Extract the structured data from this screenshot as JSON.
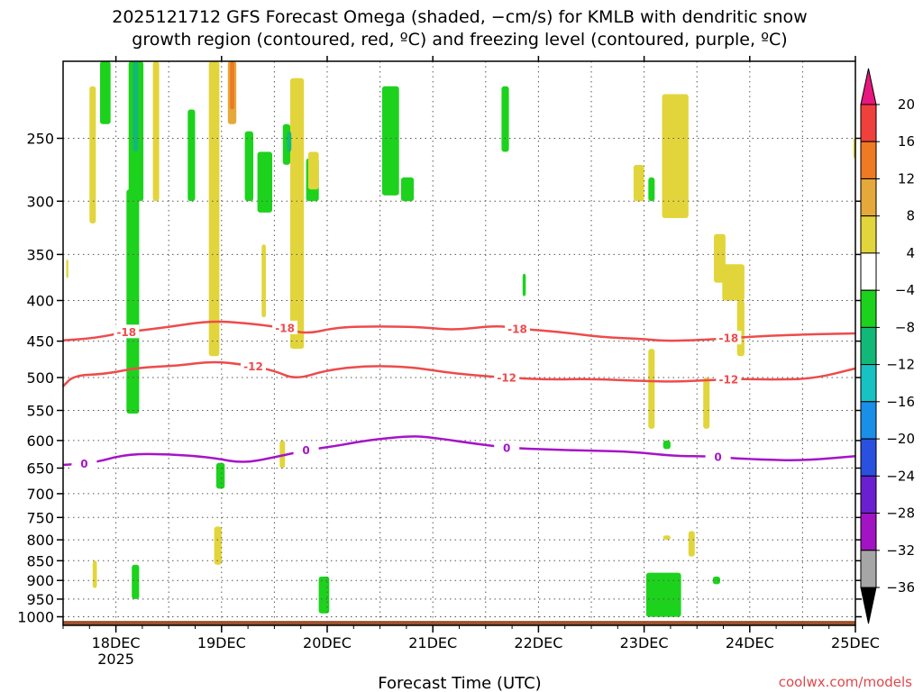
{
  "chart_data": {
    "type": "heatmap",
    "title_lines": [
      "2025121712 GFS Forecast Omega (shaded, −cm/s) for KMLB with dendritic snow",
      "growth region (contoured, red, ºC) and freezing level (contoured, purple, ºC)"
    ],
    "xlabel": "Forecast Time (UTC)",
    "x_ticks": [
      "18DEC",
      "19DEC",
      "20DEC",
      "21DEC",
      "22DEC",
      "23DEC",
      "24DEC",
      "25DEC"
    ],
    "x_tick_year": "2025",
    "x_range_days": [
      17.5,
      25.0
    ],
    "y_ticks": [
      250,
      300,
      350,
      400,
      450,
      500,
      550,
      600,
      650,
      700,
      750,
      800,
      850,
      900,
      950,
      1000
    ],
    "y_range_hpa": [
      200,
      1025
    ],
    "y_scale": "log-pressure, inverted",
    "grid": true,
    "colorbar": {
      "labels": [
        "20",
        "16",
        "12",
        "8",
        "4",
        "−4",
        "−8",
        "−12",
        "−16",
        "−20",
        "−24",
        "−28",
        "−32",
        "−36"
      ],
      "bins": [
        {
          "color": "#e8167f"
        },
        {
          "color": "#f0403c"
        },
        {
          "color": "#ee7a23"
        },
        {
          "color": "#e5a83a"
        },
        {
          "color": "#e2d53b"
        },
        {
          "color": "#ffffff"
        },
        {
          "color": "#1dd21d"
        },
        {
          "color": "#12b877"
        },
        {
          "color": "#17c2c2"
        },
        {
          "color": "#1a8fe8"
        },
        {
          "color": "#2a50e0"
        },
        {
          "color": "#6a20d0"
        },
        {
          "color": "#a213c4"
        },
        {
          "color": "#a6a6a6"
        },
        {
          "color": "#000000"
        }
      ]
    },
    "contours": [
      {
        "label": "-18",
        "color": "#ee4b4b",
        "label_at": [
          18.1,
          19.6,
          21.8,
          23.8
        ],
        "points": [
          [
            17.5,
            449
          ],
          [
            17.8,
            446
          ],
          [
            18.1,
            438
          ],
          [
            18.5,
            432
          ],
          [
            18.9,
            424
          ],
          [
            19.3,
            428
          ],
          [
            19.6,
            433
          ],
          [
            19.8,
            441
          ],
          [
            20.1,
            432
          ],
          [
            20.5,
            431
          ],
          [
            20.9,
            432
          ],
          [
            21.2,
            436
          ],
          [
            21.6,
            430
          ],
          [
            21.8,
            434
          ],
          [
            22.2,
            438
          ],
          [
            22.6,
            445
          ],
          [
            23.0,
            447
          ],
          [
            23.2,
            450
          ],
          [
            23.6,
            448
          ],
          [
            23.8,
            446
          ],
          [
            24.2,
            443
          ],
          [
            24.6,
            441
          ],
          [
            25.0,
            440
          ]
        ]
      },
      {
        "label": "-12",
        "color": "#ee4b4b",
        "label_at": [
          19.3,
          21.7,
          23.8
        ],
        "points": [
          [
            17.5,
            513
          ],
          [
            17.6,
            497
          ],
          [
            17.9,
            495
          ],
          [
            18.2,
            486
          ],
          [
            18.6,
            483
          ],
          [
            18.9,
            477
          ],
          [
            19.2,
            481
          ],
          [
            19.5,
            490
          ],
          [
            19.7,
            503
          ],
          [
            20.0,
            489
          ],
          [
            20.4,
            483
          ],
          [
            20.8,
            485
          ],
          [
            21.1,
            492
          ],
          [
            21.4,
            497
          ],
          [
            21.7,
            500
          ],
          [
            22.1,
            503
          ],
          [
            22.5,
            502
          ],
          [
            23.0,
            505
          ],
          [
            23.3,
            506
          ],
          [
            23.6,
            504
          ],
          [
            23.9,
            502
          ],
          [
            24.2,
            503
          ],
          [
            24.6,
            502
          ],
          [
            25.0,
            487
          ]
        ]
      },
      {
        "label": "0",
        "color": "#a614c8",
        "label_at": [
          17.7,
          19.8,
          21.7,
          23.7
        ],
        "points": [
          [
            17.5,
            644
          ],
          [
            17.8,
            640
          ],
          [
            18.1,
            624
          ],
          [
            18.5,
            624
          ],
          [
            18.9,
            630
          ],
          [
            19.2,
            641
          ],
          [
            19.5,
            630
          ],
          [
            19.8,
            617
          ],
          [
            20.1,
            609
          ],
          [
            20.4,
            599
          ],
          [
            20.8,
            592
          ],
          [
            21.0,
            595
          ],
          [
            21.3,
            603
          ],
          [
            21.7,
            613
          ],
          [
            22.1,
            616
          ],
          [
            22.5,
            618
          ],
          [
            22.9,
            620
          ],
          [
            23.3,
            628
          ],
          [
            23.6,
            628
          ],
          [
            23.8,
            631
          ],
          [
            24.1,
            634
          ],
          [
            24.5,
            636
          ],
          [
            25.0,
            628
          ]
        ]
      }
    ],
    "omega_regions": [
      {
        "level": 4,
        "x": [
          17.53,
          17.55
        ],
        "p": [
          355,
          375
        ]
      },
      {
        "level": 4,
        "x": [
          17.75,
          17.81
        ],
        "p": [
          215,
          320
        ]
      },
      {
        "level": -8,
        "x": [
          17.85,
          17.95
        ],
        "p": [
          200,
          240
        ]
      },
      {
        "level": -8,
        "x": [
          18.1,
          18.22
        ],
        "p": [
          290,
          555
        ]
      },
      {
        "level": -8,
        "x": [
          18.12,
          18.26
        ],
        "p": [
          200,
          300
        ]
      },
      {
        "level": -12,
        "x": [
          18.16,
          18.21
        ],
        "p": [
          200,
          260
        ]
      },
      {
        "level": 4,
        "x": [
          18.35,
          18.41
        ],
        "p": [
          200,
          300
        ]
      },
      {
        "level": -8,
        "x": [
          18.68,
          18.75
        ],
        "p": [
          230,
          300
        ]
      },
      {
        "level": 4,
        "x": [
          18.88,
          18.98
        ],
        "p": [
          200,
          470
        ]
      },
      {
        "level": 8,
        "x": [
          19.06,
          19.14
        ],
        "p": [
          200,
          240
        ]
      },
      {
        "level": 12,
        "x": [
          19.08,
          19.12
        ],
        "p": [
          200,
          230
        ]
      },
      {
        "level": -8,
        "x": [
          19.22,
          19.3
        ],
        "p": [
          245,
          300
        ]
      },
      {
        "level": -8,
        "x": [
          19.34,
          19.48
        ],
        "p": [
          260,
          310
        ]
      },
      {
        "level": 4,
        "x": [
          19.38,
          19.42
        ],
        "p": [
          340,
          420
        ]
      },
      {
        "level": 4,
        "x": [
          19.65,
          19.78
        ],
        "p": [
          210,
          460
        ]
      },
      {
        "level": -8,
        "x": [
          19.58,
          19.65
        ],
        "p": [
          240,
          270
        ]
      },
      {
        "level": -12,
        "x": [
          19.62,
          19.66
        ],
        "p": [
          245,
          260
        ]
      },
      {
        "level": -8,
        "x": [
          19.8,
          19.92
        ],
        "p": [
          265,
          300
        ]
      },
      {
        "level": 4,
        "x": [
          19.82,
          19.92
        ],
        "p": [
          260,
          290
        ]
      },
      {
        "level": -12,
        "x": [
          20.55,
          20.62
        ],
        "p": [
          240,
          275
        ]
      },
      {
        "level": -8,
        "x": [
          20.52,
          20.68
        ],
        "p": [
          215,
          295
        ]
      },
      {
        "level": -8,
        "x": [
          20.7,
          20.82
        ],
        "p": [
          280,
          300
        ]
      },
      {
        "level": -8,
        "x": [
          21.65,
          21.72
        ],
        "p": [
          215,
          260
        ]
      },
      {
        "level": -8,
        "x": [
          21.85,
          21.88
        ],
        "p": [
          370,
          395
        ]
      },
      {
        "level": 4,
        "x": [
          22.9,
          23.0
        ],
        "p": [
          270,
          300
        ]
      },
      {
        "level": -8,
        "x": [
          23.04,
          23.1
        ],
        "p": [
          280,
          300
        ]
      },
      {
        "level": 4,
        "x": [
          23.17,
          23.42
        ],
        "p": [
          220,
          315
        ]
      },
      {
        "level": 4,
        "x": [
          23.66,
          23.77
        ],
        "p": [
          330,
          380
        ]
      },
      {
        "level": 4,
        "x": [
          23.74,
          23.95
        ],
        "p": [
          360,
          400
        ]
      },
      {
        "level": 4,
        "x": [
          23.88,
          23.95
        ],
        "p": [
          400,
          470
        ]
      },
      {
        "level": 4,
        "x": [
          24.98,
          25.0
        ],
        "p": [
          250,
          265
        ]
      },
      {
        "level": 4,
        "x": [
          23.04,
          23.1
        ],
        "p": [
          460,
          580
        ]
      },
      {
        "level": 4,
        "x": [
          23.56,
          23.62
        ],
        "p": [
          500,
          580
        ]
      },
      {
        "level": -8,
        "x": [
          23.18,
          23.25
        ],
        "p": [
          600,
          615
        ]
      },
      {
        "level": 4,
        "x": [
          19.55,
          19.6
        ],
        "p": [
          600,
          650
        ]
      },
      {
        "level": -8,
        "x": [
          18.95,
          19.03
        ],
        "p": [
          640,
          690
        ]
      },
      {
        "level": 4,
        "x": [
          18.93,
          19.0
        ],
        "p": [
          770,
          860
        ]
      },
      {
        "level": 4,
        "x": [
          17.78,
          17.82
        ],
        "p": [
          850,
          920
        ]
      },
      {
        "level": -8,
        "x": [
          18.15,
          18.22
        ],
        "p": [
          860,
          950
        ]
      },
      {
        "level": -8,
        "x": [
          19.92,
          20.02
        ],
        "p": [
          890,
          990
        ]
      },
      {
        "level": -8,
        "x": [
          23.02,
          23.35
        ],
        "p": [
          880,
          1000
        ]
      },
      {
        "level": -8,
        "x": [
          23.65,
          23.72
        ],
        "p": [
          890,
          910
        ]
      },
      {
        "level": 4,
        "x": [
          23.42,
          23.48
        ],
        "p": [
          780,
          840
        ]
      },
      {
        "level": 4,
        "x": [
          23.18,
          23.25
        ],
        "p": [
          790,
          800
        ]
      }
    ]
  },
  "credit": "coolwx.com/models"
}
